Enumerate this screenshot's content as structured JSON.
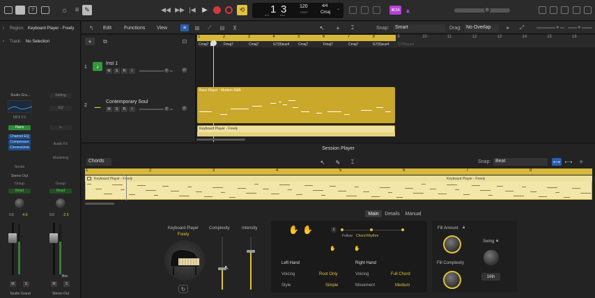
{
  "transport": {
    "bar": "1",
    "beat": "3",
    "bar_label": "BAR",
    "beat_label": "BEAT",
    "tempo": "120",
    "tempo_label": "KEEP",
    "sig": "4/4",
    "key": "Cmaj",
    "badge": "⌘34"
  },
  "inspector": {
    "region_label": "Region:",
    "region_value": "Keyboard Player - Freely",
    "track_label": "Track:",
    "track_value": "No Selection"
  },
  "strip1": {
    "name_top": "Studio Gra...",
    "midi_fx": "MIDI FX",
    "instrument": "Piano",
    "fx": [
      "Channel EQ",
      "Compressor",
      "ChromaVerb"
    ],
    "sends": "Sends",
    "output": "Stereo Out",
    "mode": "Read",
    "group": "Group",
    "vol": "0.0",
    "pk": "-4.6",
    "m": "M",
    "s": "S",
    "name_bottom": "Studio Grand"
  },
  "strip2": {
    "setting": "Setting",
    "eq": "EQ",
    "link": "∞",
    "audio_fx": "Audio FX",
    "mastering": "Mastering",
    "group": "Group",
    "mode": "Read",
    "vol": "0.0",
    "pk": "-2.6",
    "m": "M",
    "s": "S",
    "bnc": "Bnc",
    "name_bottom": "Stereo Out"
  },
  "tracks_toolbar": {
    "edit": "Edit",
    "functions": "Functions",
    "view": "View",
    "snap_label": "Snap:",
    "snap_value": "Smart",
    "drag_label": "Drag:",
    "drag_value": "No Overlap"
  },
  "ruler_top": [
    "1",
    "2",
    "3",
    "4",
    "5",
    "6",
    "7",
    "8",
    "9",
    "10",
    "11",
    "12",
    "13",
    "14",
    "15",
    "16"
  ],
  "chords_top": [
    "Cmaj7",
    "Fmaj7",
    "Cmaj7",
    "G7(9)sus4",
    "Cmaj7",
    "Fmaj7",
    "Cmaj7",
    "G7(9)sus4",
    "C7(9)sus4"
  ],
  "tracks": [
    {
      "num": "1",
      "name": "Inst 1"
    },
    {
      "num": "2",
      "name": "Contemporary Soul"
    }
  ],
  "regions": {
    "bass": "Bass Player - Modern R&B",
    "keys": "Keyboard Player - Freely"
  },
  "session": {
    "title": "Session Player",
    "chords_menu": "Chords",
    "snap_label": "Snap:",
    "snap_value": "Beat",
    "ruler": [
      "1",
      "2",
      "3",
      "4",
      "5",
      "6",
      "7",
      "8"
    ],
    "region_left": "Keyboard Player - Freely",
    "region_right": "Keyboard Player - Freely",
    "tabs": [
      "Main",
      "Details",
      "Manual"
    ],
    "player_title": "Keyboard Player",
    "player_style": "Freely",
    "complexity": "Complexity",
    "intensity": "Intensity",
    "follow_label": "Follow:",
    "follow_value": "Chord Rhythm",
    "left_hand": "Left Hand",
    "right_hand": "Right Hand",
    "lh_voicing_label": "Voicing",
    "lh_voicing_value": "Root Only",
    "lh_style_label": "Style",
    "lh_style_value": "Simple",
    "rh_voicing_label": "Voicing",
    "rh_voicing_value": "Full Chord",
    "rh_movement_label": "Movement",
    "rh_movement_value": "Medium",
    "fill_amount": "Fill Amount",
    "fill_complexity": "Fill Complexity",
    "swing": "Swing",
    "swing_value": "16th",
    "step_one": "1"
  },
  "colors": {
    "accent": "#e0c23c",
    "region": "#c9a82a",
    "region_light": "#efe2a0",
    "badge": "#b441d6"
  }
}
